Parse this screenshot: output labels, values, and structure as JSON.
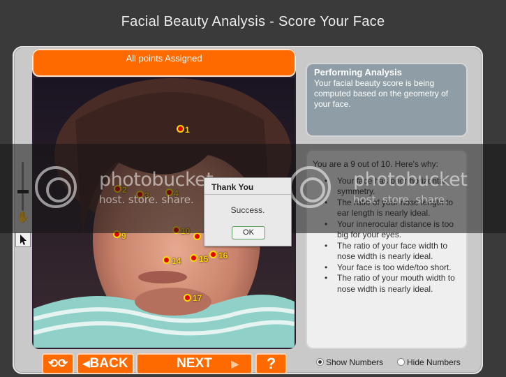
{
  "app_title": "Facial Beauty Analysis - Score Your Face",
  "status_banner": "All points Assigned",
  "info": {
    "title": "Performing Analysis",
    "text": "Your facial beauty score is being computed based on the geometry of your face."
  },
  "results": {
    "summary": "You are a 9 out of 10.  Here's why:",
    "items": [
      "Your face has poor horizontal symmetry.",
      "The ratio of your nose length to ear length is nearly ideal.",
      "Your innerocular distance is too big for your eyes.",
      "The ratio of your face width to nose width is nearly ideal.",
      "Your face is too wide/too short.",
      "The ratio of your mouth width to nose width is nearly ideal."
    ]
  },
  "dialog": {
    "title": "Thank You",
    "message": "Success.",
    "ok_label": "OK"
  },
  "markers": [
    "1",
    "2",
    "3",
    "4",
    "9",
    "10",
    "14",
    "15",
    "16",
    "17"
  ],
  "buttons": {
    "reset_icon": "refresh-icon",
    "back_label": "BACK",
    "next_label": "NEXT",
    "help_label": "?"
  },
  "display_options": {
    "show_numbers": "Show Numbers",
    "hide_numbers": "Hide Numbers",
    "selected": "Show Numbers"
  },
  "watermark": {
    "brand": "photobucket",
    "tagline": "host. store. share."
  },
  "colors": {
    "accent": "#ff6a00",
    "marker": "#e20000",
    "marker_ring": "#ffdc00",
    "info_panel": "#8f9ea6"
  }
}
